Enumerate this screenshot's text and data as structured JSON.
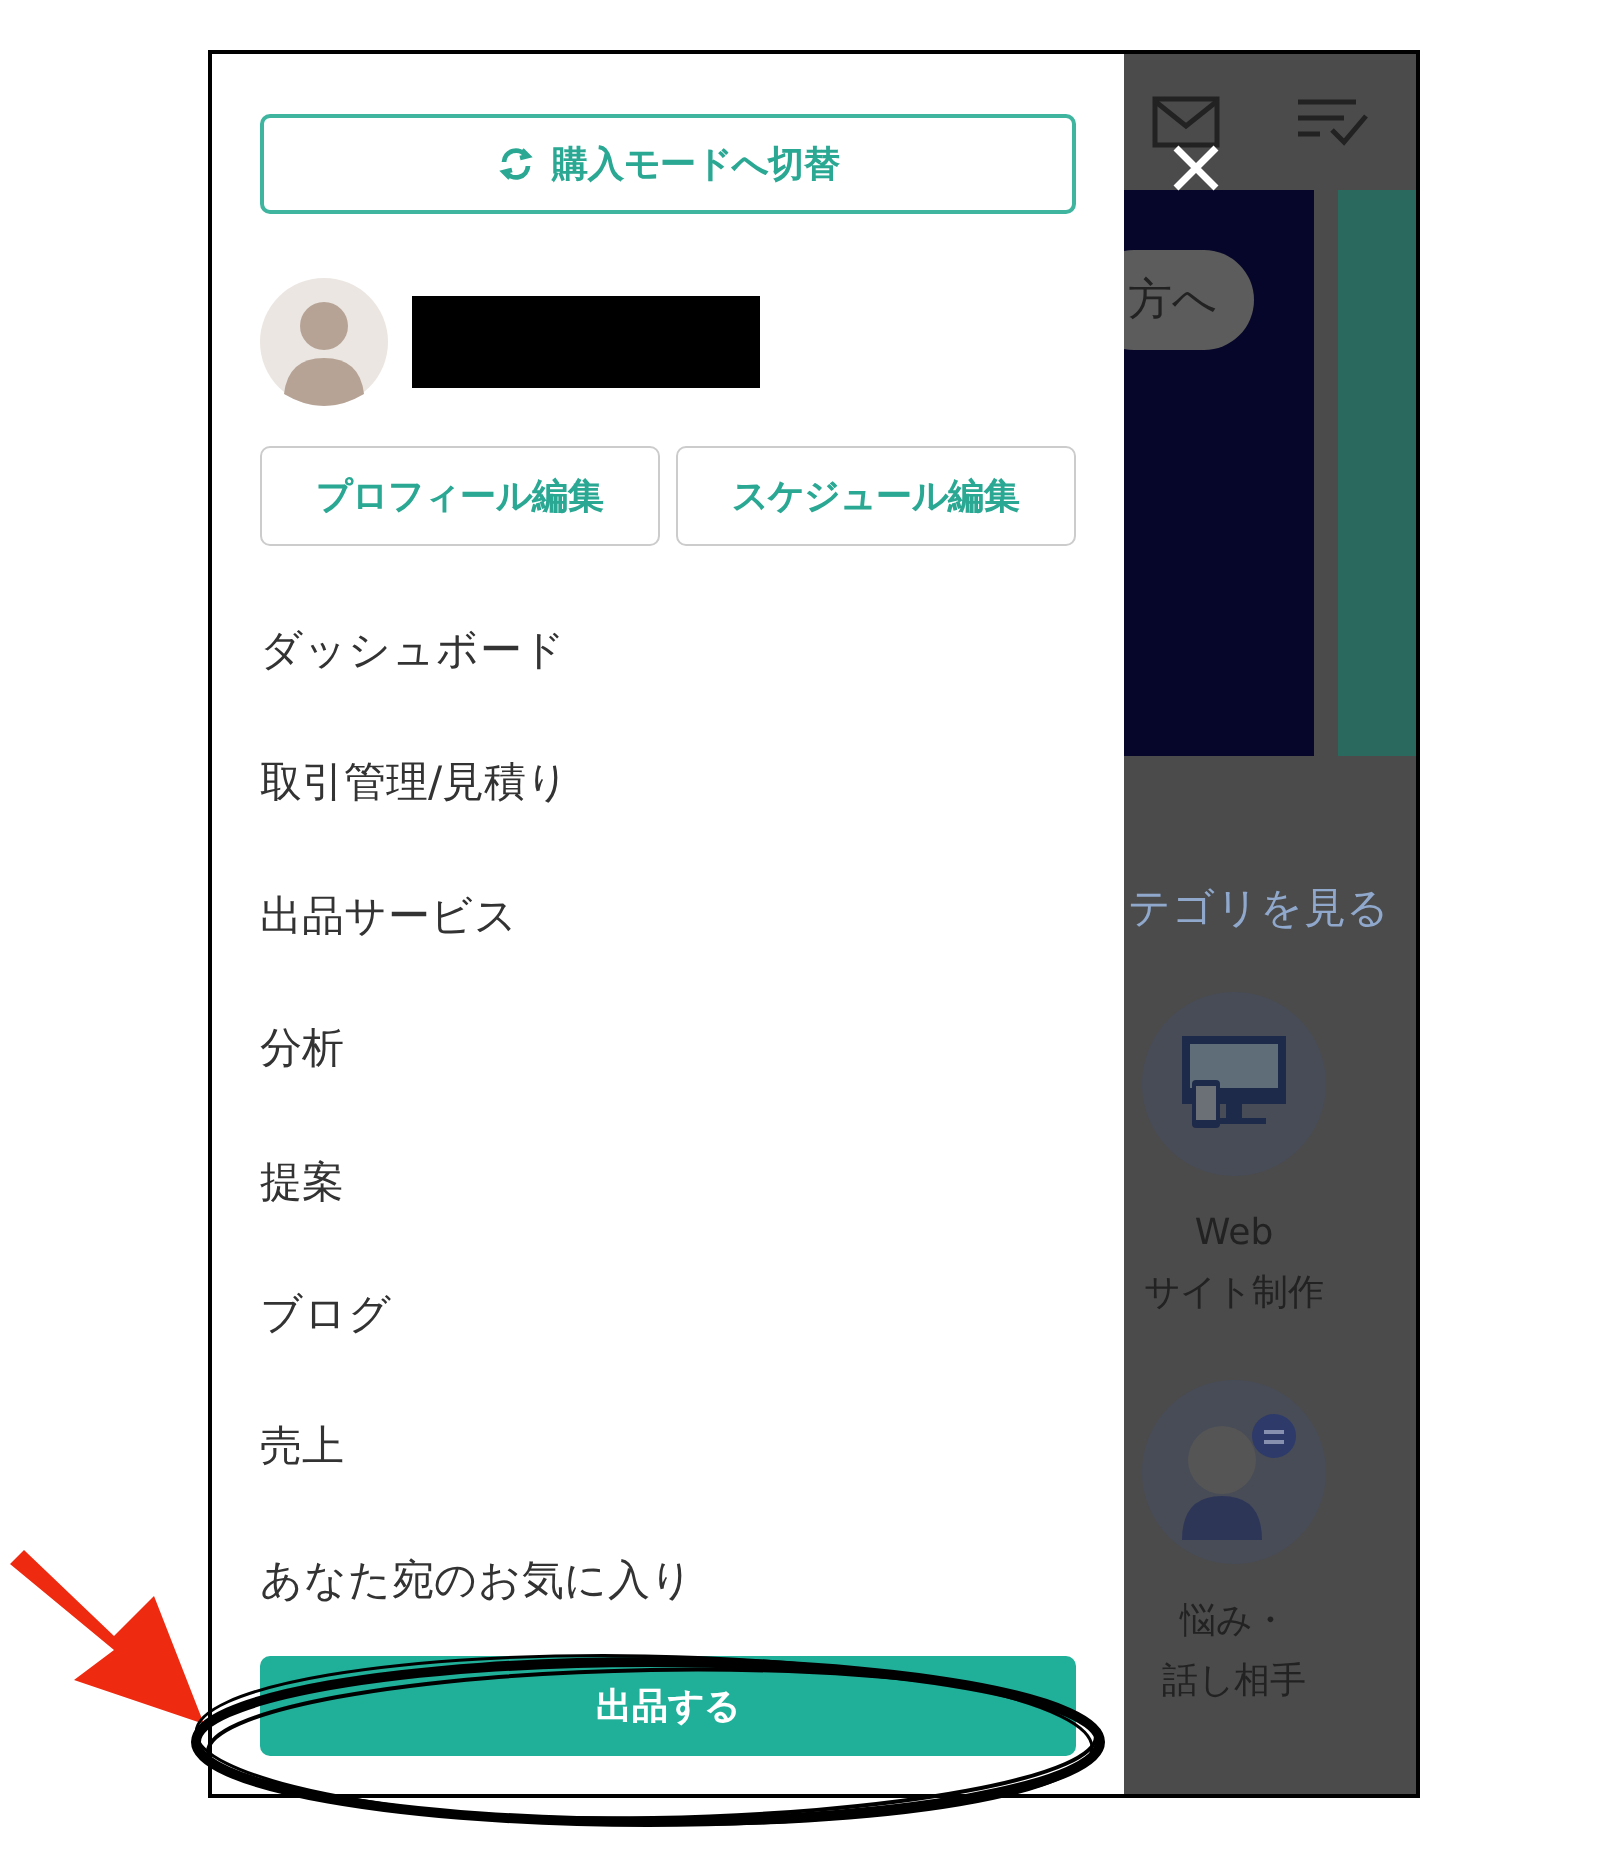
{
  "drawer": {
    "mode_switch_button": "購入モードへ切替",
    "profile_buttons": [
      "プロフィール編集",
      "スケジュール編集"
    ],
    "menu": [
      "ダッシュボード",
      "取引管理/見積り",
      "出品サービス",
      "分析",
      "提案",
      "ブログ",
      "売上",
      "あなた宛のお気に入り"
    ],
    "primary_button": "出品する"
  },
  "background": {
    "banner_text": "方へ",
    "category_link": "テゴリを見る",
    "categories": [
      {
        "kind": "monitor",
        "label_lines": [
          "Web",
          "サイト制作"
        ]
      },
      {
        "kind": "person",
        "label_lines": [
          "悩み・",
          "話し相手"
        ]
      }
    ]
  }
}
